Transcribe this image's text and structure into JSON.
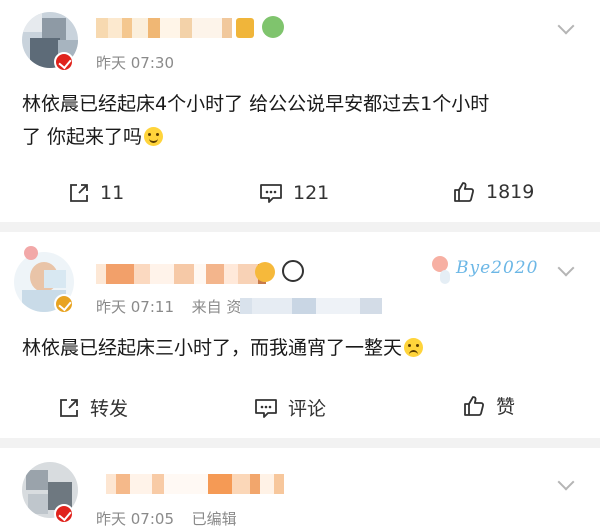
{
  "post1": {
    "time": "昨天 07:30",
    "text_line1": "林依晨已经起床4个小时了 给公公说早安都过去1个小时",
    "text_line2": "了 你起来了吗",
    "actions": {
      "share_count": "11",
      "comment_count": "121",
      "like_count": "1819"
    }
  },
  "post2": {
    "meta_time": "昨天 07:11",
    "meta_source": "来自 资",
    "decor_text": "Bye2020",
    "text": "林依晨已经起床三小时了，而我通宵了一整天",
    "actions": {
      "share_label": "转发",
      "comment_label": "评论",
      "like_label": "赞"
    }
  },
  "post3": {
    "time": "昨天 07:05",
    "edited": "已编辑"
  },
  "colors": {
    "badge_gold": "#e8a321",
    "badge_red": "#e0231c",
    "meta_gray": "#8a8a8a",
    "separator": "#f2f2f2"
  },
  "icons": [
    "share-icon",
    "comment-icon",
    "like-icon",
    "chevron-down-icon",
    "verified-badge-icon",
    "smile-emoji-icon",
    "sad-emoji-icon",
    "crown-emoji-icon",
    "panda-emoji-icon"
  ]
}
